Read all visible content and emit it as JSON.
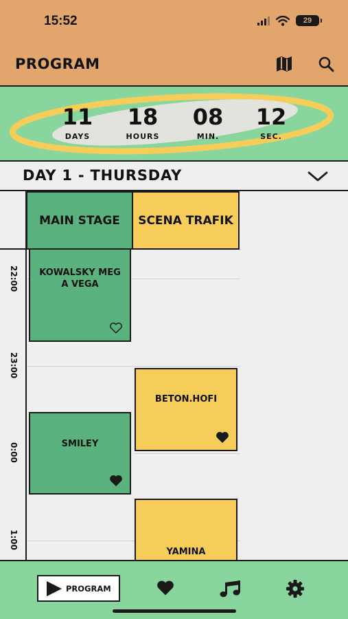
{
  "status_bar": {
    "time": "15:52",
    "battery": "29"
  },
  "header": {
    "title": "PROGRAM",
    "icons": [
      "map-icon",
      "search-icon"
    ]
  },
  "countdown": {
    "units": [
      {
        "value": "11",
        "label": "DAYS"
      },
      {
        "value": "18",
        "label": "HOURS"
      },
      {
        "value": "08",
        "label": "MIN."
      },
      {
        "value": "12",
        "label": "SEC."
      }
    ]
  },
  "day_selector": {
    "label": "DAY 1 - THURSDAY"
  },
  "stages": [
    {
      "name": "MAIN STAGE"
    },
    {
      "name": "SCENA TRAFIK"
    }
  ],
  "times": [
    "22:00",
    "23:00",
    "0:00",
    "1:00"
  ],
  "events": [
    {
      "name": "KOWALSKY MEG A VEGA",
      "stage": "MAIN STAGE",
      "favorited": false
    },
    {
      "name": "SMILEY",
      "stage": "MAIN STAGE",
      "favorited": true
    },
    {
      "name": "BETON.HOFI",
      "stage": "SCENA TRAFIK",
      "favorited": true
    },
    {
      "name": "YAMINA",
      "stage": "SCENA TRAFIK",
      "favorited": false
    }
  ],
  "tabbar": {
    "program_label": "PROGRAM",
    "icons": [
      "play-icon",
      "heart-icon",
      "music-note-icon",
      "gear-icon"
    ]
  },
  "colors": {
    "header": "#e2a66d",
    "countdown_bg": "#88d69d",
    "ring": "#f6cd58",
    "main_stage": "#5ab27f",
    "scena_trafik": "#f6cd58",
    "tabbar": "#88d69d"
  }
}
